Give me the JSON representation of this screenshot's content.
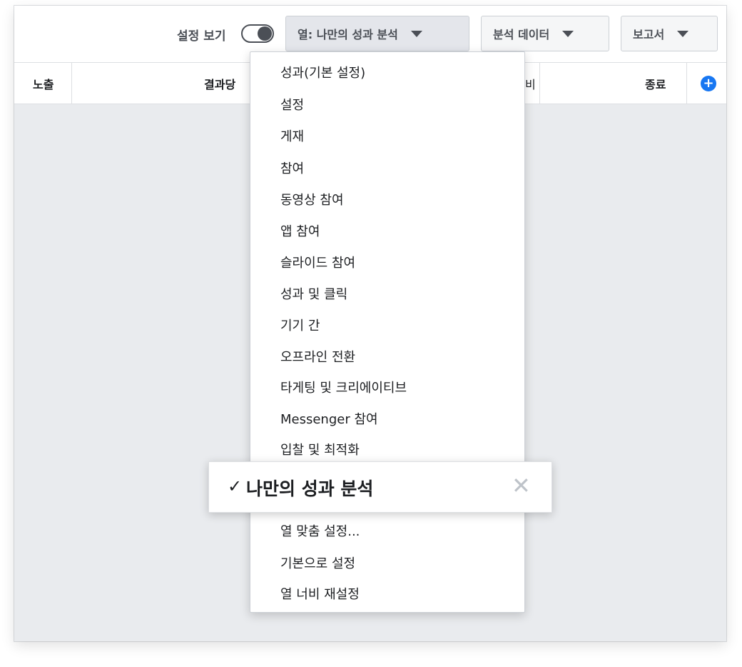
{
  "toolbar": {
    "toggle_label": "설정 보기",
    "columns_label": "열: 나만의 성과 분석",
    "breakdown_label": "분석 데이터",
    "reports_label": "보고서"
  },
  "table": {
    "headers": [
      "노출",
      "결과당",
      "비",
      "종료"
    ]
  },
  "menu": {
    "items": [
      "성과(기본 설정)",
      "설정",
      "게재",
      "참여",
      "동영상 참여",
      "앱 참여",
      "슬라이드 참여",
      "성과 및 클릭",
      "기기 간",
      "오프라인 전환",
      "타게팅 및 크리에이티브",
      "Messenger 참여",
      "입찰 및 최적화"
    ],
    "selected": {
      "check": "✓",
      "label": "나만의 성과 분석",
      "close": "✕"
    },
    "footer_items": [
      "열 맞춤 설정...",
      "기본으로 설정",
      "열 너비 재설정"
    ]
  },
  "colors": {
    "accent": "#1877f2",
    "text": "#1c1e21",
    "muted": "#4b4f56",
    "panel_bg": "#e9ebee"
  }
}
